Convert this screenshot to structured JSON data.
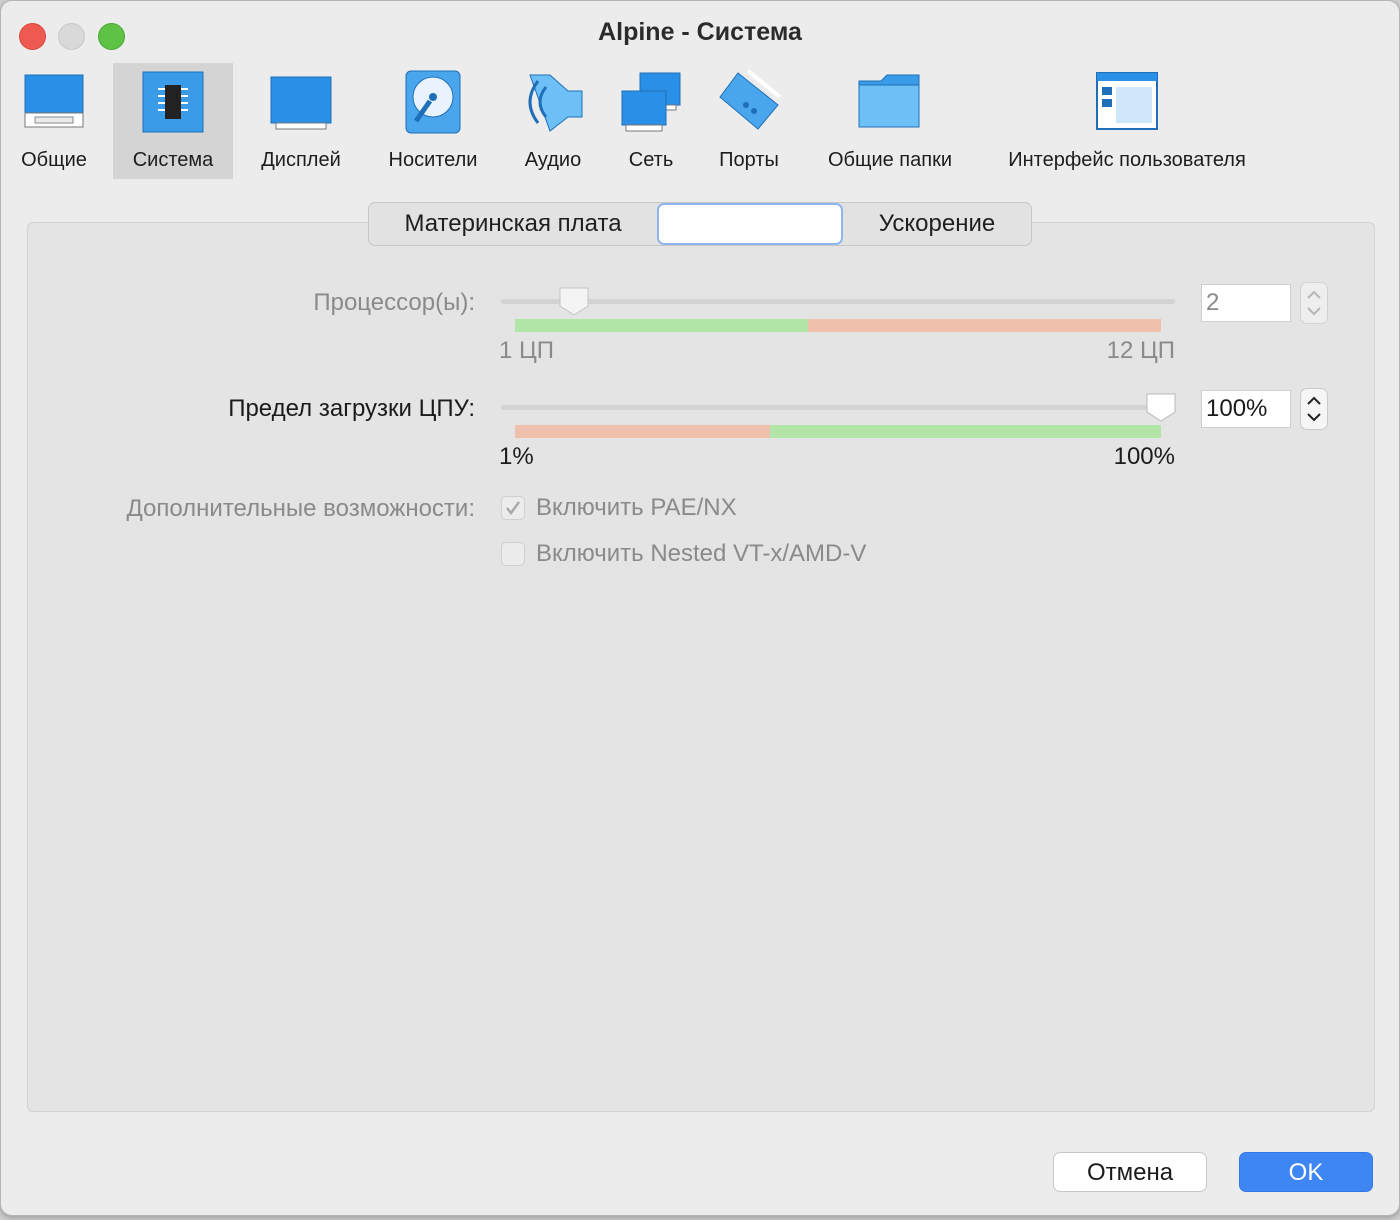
{
  "window": {
    "title": "Alpine - Система"
  },
  "toolbar": {
    "items": [
      {
        "label": "Общие",
        "icon": "general-icon",
        "selected": false
      },
      {
        "label": "Система",
        "icon": "system-chip-icon",
        "selected": true
      },
      {
        "label": "Дисплей",
        "icon": "display-icon",
        "selected": false
      },
      {
        "label": "Носители",
        "icon": "storage-disk-icon",
        "selected": false
      },
      {
        "label": "Аудио",
        "icon": "audio-speaker-icon",
        "selected": false
      },
      {
        "label": "Сеть",
        "icon": "network-icon",
        "selected": false
      },
      {
        "label": "Порты",
        "icon": "ports-icon",
        "selected": false
      },
      {
        "label": "Общие папки",
        "icon": "shared-folder-icon",
        "selected": false
      },
      {
        "label": "Интерфейс пользователя",
        "icon": "user-interface-icon",
        "selected": false
      }
    ]
  },
  "tabs": {
    "motherboard": "Материнская плата",
    "processor": "",
    "acceleration": "Ускорение"
  },
  "processors": {
    "label": "Процессор(ы):",
    "value": "2",
    "min_label": "1 ЦП",
    "max_label": "12 ЦП",
    "min": 1,
    "max": 12,
    "current": 2,
    "enabled": false
  },
  "cpu_limit": {
    "label": "Предел загрузки ЦПУ:",
    "value": "100%",
    "min_label": "1%",
    "max_label": "100%",
    "min": 1,
    "max": 100,
    "current": 100,
    "enabled": true
  },
  "extended": {
    "label": "Дополнительные возможности:",
    "pae_label": "Включить PAE/NX",
    "pae_checked": true,
    "nested_label": "Включить Nested VT-x/AMD-V",
    "nested_checked": false
  },
  "buttons": {
    "cancel": "Отмена",
    "ok": "OK"
  },
  "colors": {
    "accent": "#3f86f5",
    "ok_zone": "#b2e6a8",
    "warn_zone": "#efc1ad"
  }
}
